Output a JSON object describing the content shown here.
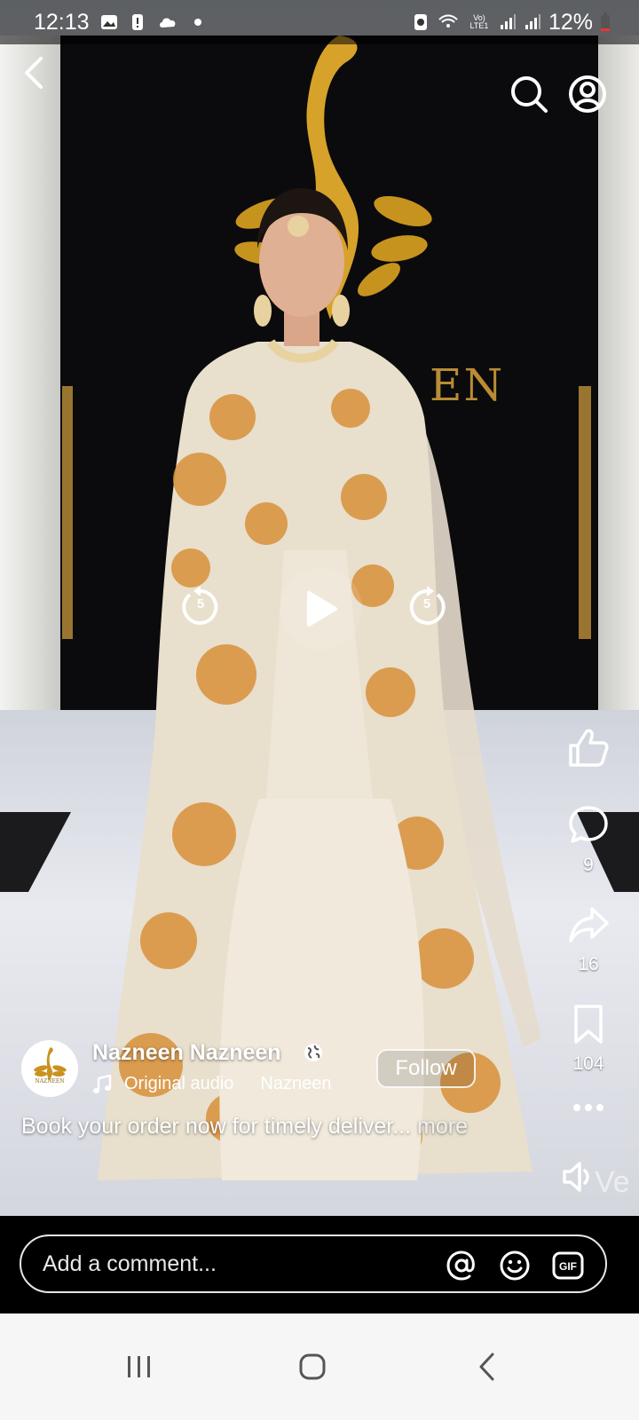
{
  "status_bar": {
    "time": "12:13",
    "battery": "12%",
    "network": "Vo) LTE1"
  },
  "video": {
    "brand_backdrop_text": "EN",
    "skip_back_seconds": "5",
    "skip_forward_seconds": "5",
    "watermark": "Ve"
  },
  "actions": {
    "likes": "",
    "comments": "9",
    "shares": "16",
    "saves": "104"
  },
  "author": {
    "name": "Nazneen Nazneen",
    "avatar_text": "NAZNEEN",
    "audio_label": "Original audio",
    "audio_source": "Nazneen",
    "follow_label": "Follow"
  },
  "caption": {
    "text": "Book your order now for timely deliver...",
    "more_label": "more"
  },
  "comment_bar": {
    "placeholder": "Add a comment..."
  },
  "icons": {
    "back": "chevron-left-icon",
    "search": "search-icon",
    "profile": "profile-icon",
    "like": "thumbs-up-icon",
    "comment": "comment-icon",
    "share": "share-icon",
    "save": "bookmark-icon",
    "more": "more-icon",
    "sound": "speaker-icon",
    "mention": "at-icon",
    "emoji": "emoji-icon",
    "gif": "gif-icon"
  },
  "colors": {
    "gold": "#b98c35",
    "backdrop": "#0b0b0d",
    "garment": "#e9dfcc",
    "embroidery": "#d8913a"
  }
}
